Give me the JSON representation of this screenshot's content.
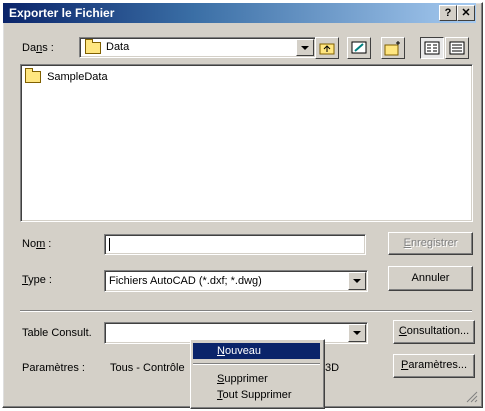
{
  "window": {
    "title": "Exporter le Fichier",
    "help_btn": "?",
    "close_btn": "✕"
  },
  "lookin": {
    "label_pre": "Da",
    "label_u": "n",
    "label_post": "s :",
    "value": "Data"
  },
  "files": [
    {
      "name": "SampleData",
      "icon": "folder-icon"
    }
  ],
  "name_field": {
    "label_pre": "No",
    "label_u": "m",
    "label_post": " :",
    "value": ""
  },
  "type_field": {
    "label_u": "T",
    "label_post": "ype :",
    "value": "Fichiers AutoCAD (*.dxf; *.dwg)"
  },
  "buttons": {
    "save_u": "E",
    "save_rest": "nregistrer",
    "cancel": "Annuler",
    "consult_u": "C",
    "consult_rest": "onsultation...",
    "params_u": "P",
    "params_rest": "aramètres..."
  },
  "table_consult": {
    "label": "Table Consult.",
    "value": ""
  },
  "params": {
    "label": "Paramètres :",
    "value_left": "Tous - Contrôle",
    "value_right": "3D"
  },
  "menu": {
    "new_u": "N",
    "new_rest": "ouveau",
    "delete_u": "S",
    "delete_rest": "upprimer",
    "delete_all_u": "T",
    "delete_all_rest": "out Supprimer"
  }
}
